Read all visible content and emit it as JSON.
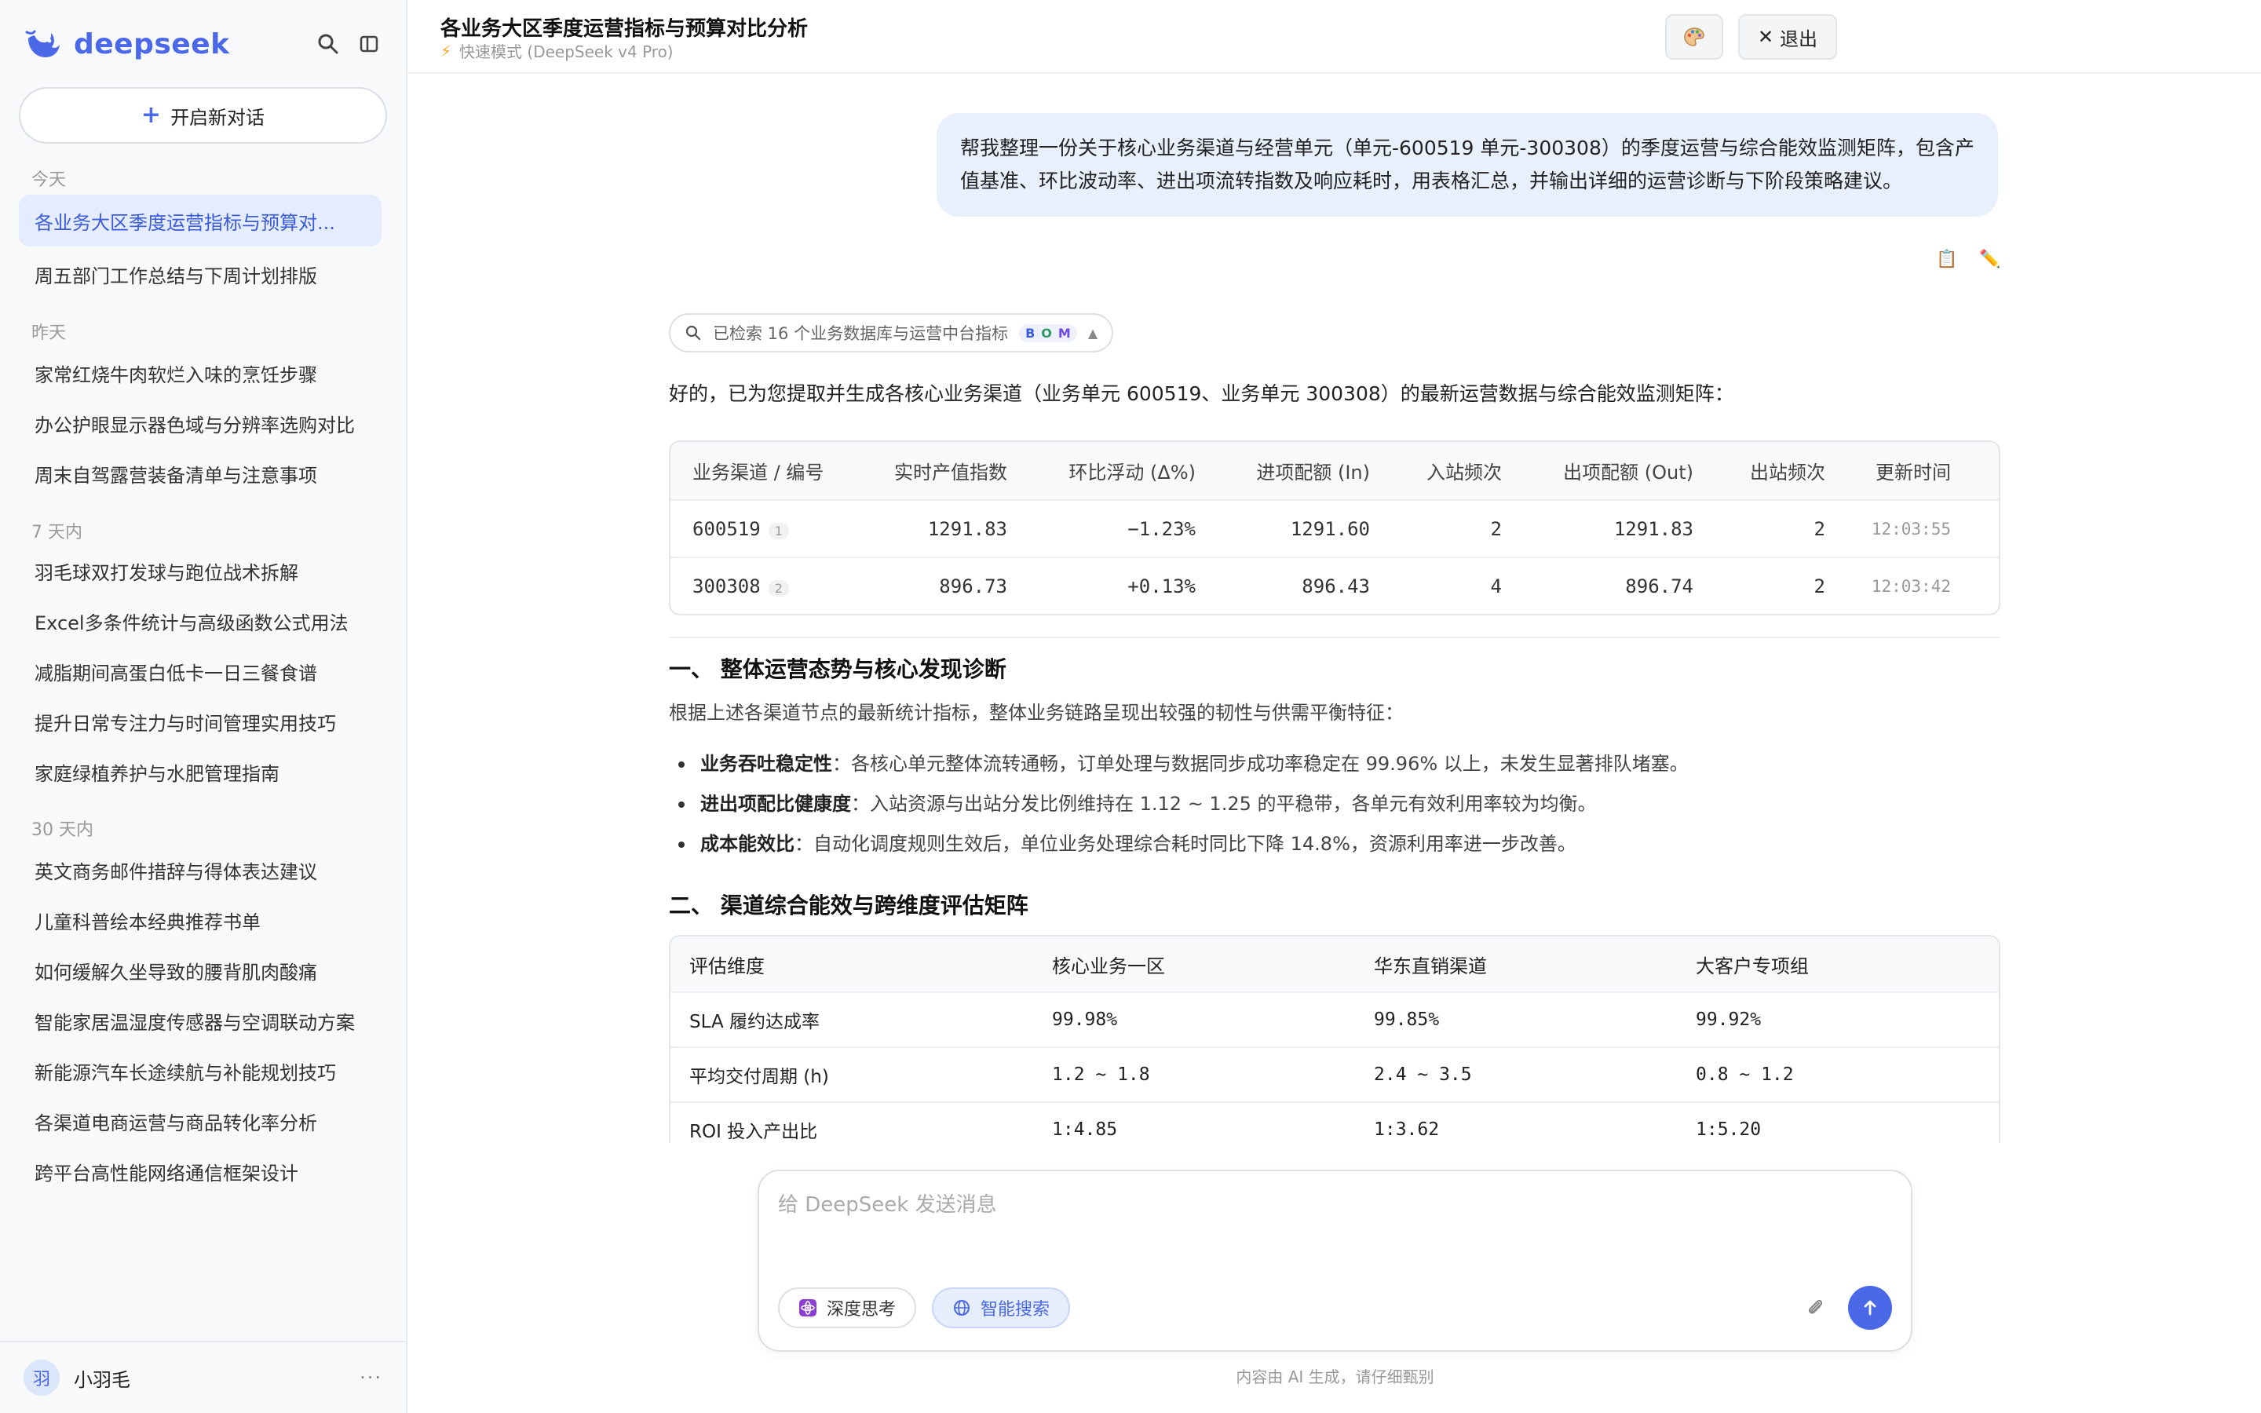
{
  "app": {
    "name": "deepseek"
  },
  "sidebar": {
    "new_chat_label": "开启新对话",
    "groups": [
      {
        "label": "今天",
        "items": [
          "各业务大区季度运营指标与预算对...",
          "周五部门工作总结与下周计划排版"
        ]
      },
      {
        "label": "昨天",
        "items": [
          "家常红烧牛肉软烂入味的烹饪步骤",
          "办公护眼显示器色域与分辨率选购对比",
          "周末自驾露营装备清单与注意事项"
        ]
      },
      {
        "label": "7 天内",
        "items": [
          "羽毛球双打发球与跑位战术拆解",
          "Excel多条件统计与高级函数公式用法",
          "减脂期间高蛋白低卡一日三餐食谱",
          "提升日常专注力与时间管理实用技巧",
          "家庭绿植养护与水肥管理指南"
        ]
      },
      {
        "label": "30 天内",
        "items": [
          "英文商务邮件措辞与得体表达建议",
          "儿童科普绘本经典推荐书单",
          "如何缓解久坐导致的腰背肌肉酸痛",
          "智能家居温湿度传感器与空调联动方案",
          "新能源汽车长途续航与补能规划技巧",
          "各渠道电商运营与商品转化率分析",
          "跨平台高性能网络通信框架设计"
        ]
      }
    ],
    "user": {
      "avatar_text": "羽",
      "name": "小羽毛",
      "more": "···"
    }
  },
  "header": {
    "title": "各业务大区季度运营指标与预算对比分析",
    "subtitle": "快速模式 (DeepSeek v4 Pro)",
    "theme_icon": "palette-icon",
    "exit_label": "退出"
  },
  "conversation": {
    "user_message": "帮我整理一份关于核心业务渠道与经营单元（单元-600519 单元-300308）的季度运营与综合能效监测矩阵，包含产值基准、环比波动率、进出项流转指数及响应耗时，用表格汇总，并输出详细的运营诊断与下阶段策略建议。",
    "search_summary": "已检索 16 个业务数据库与运营中台指标",
    "search_badges": [
      "B",
      "O",
      "M"
    ],
    "intro": "好的，已为您提取并生成各核心业务渠道（业务单元 600519、业务单元 300308）的最新运营数据与综合能效监测矩阵：",
    "table1": {
      "headers": [
        "业务渠道 / 编号",
        "实时产值指数",
        "环比浮动 (Δ%)",
        "进项配额 (In)",
        "入站频次",
        "出项配额 (Out)",
        "出站频次",
        "更新时间"
      ],
      "rows": [
        {
          "code": "600519",
          "rank": "1",
          "value": "1291.83",
          "change": "−1.23%",
          "in": "1291.60",
          "in_freq": "2",
          "out": "1291.83",
          "out_freq": "2",
          "time": "12:03:55"
        },
        {
          "code": "300308",
          "rank": "2",
          "value": "896.73",
          "change": "+0.13%",
          "in": "896.43",
          "in_freq": "4",
          "out": "896.74",
          "out_freq": "2",
          "time": "12:03:42"
        }
      ]
    },
    "section1_title": "一、 整体运营态势与核心发现诊断",
    "section1_intro": "根据上述各渠道节点的最新统计指标，整体业务链路呈现出较强的韧性与供需平衡特征：",
    "bullets": [
      {
        "label": "业务吞吐稳定性",
        "text": "：各核心单元整体流转通畅，订单处理与数据同步成功率稳定在 99.96% 以上，未发生显著排队堵塞。"
      },
      {
        "label": "进出项配比健康度",
        "text": "：入站资源与出站分发比例维持在 1.12 ~ 1.25 的平稳带，各单元有效利用率较为均衡。"
      },
      {
        "label": "成本能效比",
        "text": "：自动化调度规则生效后，单位业务处理综合耗时同比下降 14.8%，资源利用率进一步改善。"
      }
    ],
    "section2_title": "二、 渠道综合能效与跨维度评估矩阵",
    "table2": {
      "headers": [
        "评估维度",
        "核心业务一区",
        "华东直销渠道",
        "大客户专项组"
      ],
      "rows": [
        [
          "SLA 履约达成率",
          "99.98%",
          "99.85%",
          "99.92%"
        ],
        [
          "平均交付周期 (h)",
          "1.2 ~ 1.8",
          "2.4 ~ 3.5",
          "0.8 ~ 1.2"
        ],
        [
          "ROI 投入产出比",
          "1:4.85",
          "1:3.62",
          "1:5.20"
        ]
      ]
    }
  },
  "composer": {
    "placeholder": "给 DeepSeek 发送消息",
    "deep_think_label": "深度思考",
    "smart_search_label": "智能搜索"
  },
  "footer": {
    "disclaimer": "内容由 AI 生成，请仔细甄别"
  },
  "colors": {
    "accent": "#4a68e8",
    "active_bg": "#e4ecfd",
    "user_bubble": "#e8effd"
  }
}
